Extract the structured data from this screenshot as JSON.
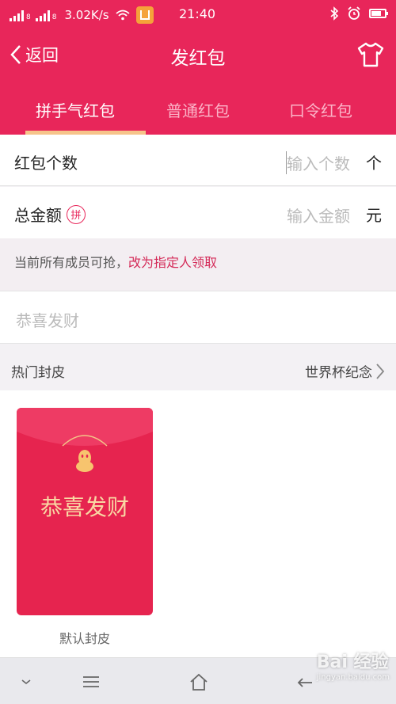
{
  "status_bar": {
    "carrier1": "8",
    "carrier2": "8",
    "net_speed": "3.02K/s",
    "time": "21:40"
  },
  "header": {
    "back_label": "返回",
    "title": "发红包"
  },
  "tabs": [
    {
      "label": "拼手气红包",
      "active": true
    },
    {
      "label": "普通红包",
      "active": false
    },
    {
      "label": "口令红包",
      "active": false
    }
  ],
  "form": {
    "count": {
      "label": "红包个数",
      "placeholder": "输入个数",
      "unit": "个"
    },
    "amount": {
      "label": "总金额",
      "badge": "拼",
      "placeholder": "输入金额",
      "unit": "元"
    }
  },
  "notice": {
    "text": "当前所有成员可抢，",
    "link": "改为指定人领取"
  },
  "greeting": {
    "placeholder": "恭喜发财"
  },
  "skins": {
    "section_title": "热门封皮",
    "more_label": "世界杯纪念",
    "items": [
      {
        "envelope_text": "恭喜发财",
        "caption": "默认封皮"
      }
    ]
  },
  "watermark": {
    "brand": "Bai 经验",
    "url": "jingyan.baidu.com"
  },
  "colors": {
    "primary": "#e8265a",
    "tab_indicator": "#f6c48a",
    "link": "#d42a58",
    "envelope_text": "#f9d7a3"
  }
}
